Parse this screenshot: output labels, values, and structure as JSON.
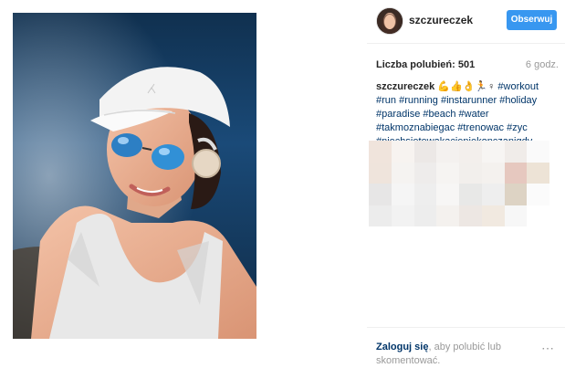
{
  "post": {
    "username": "szczureczek",
    "follow_label": "Obserwuj",
    "likes_label": "Liczba polubień:",
    "likes_count": "501",
    "time_ago": "6 godz.",
    "caption_user": "szczureczek",
    "caption_emoji": "💪👍👌🏃♀",
    "hashtags": [
      "#workout",
      "#run",
      "#running",
      "#instarunner",
      "#holiday",
      "#paradise",
      "#beach",
      "#water",
      "#takmoznabiegac",
      "#trenowac",
      "#zyc",
      "#niechsietewakacjeniekonczanigdy"
    ]
  },
  "footer": {
    "login_link": "Zaloguj się",
    "login_rest": ", aby polubić lub skomentować.",
    "more_icon": "⋯"
  },
  "icons": {
    "avatar": "avatar",
    "more": "more-options-icon"
  },
  "colors": {
    "accent": "#3897f0",
    "link": "#003569",
    "muted": "#999999"
  }
}
